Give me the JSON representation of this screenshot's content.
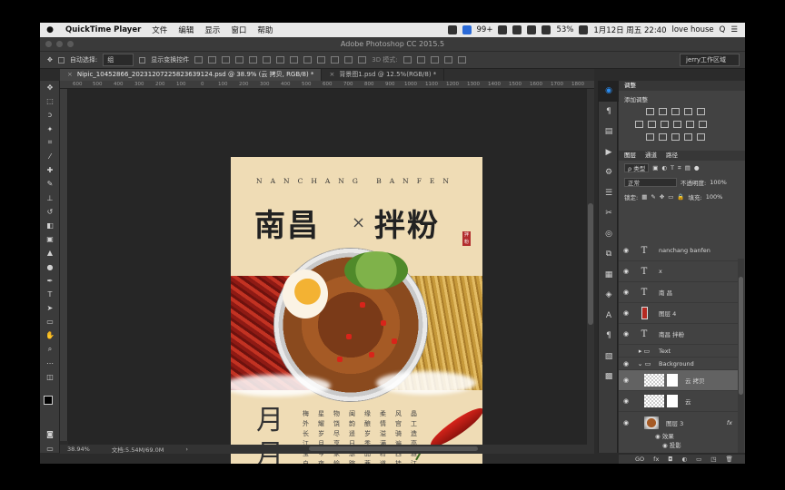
{
  "menubar": {
    "apple": "",
    "app": "QuickTime Player",
    "items": [
      "文件",
      "编辑",
      "显示",
      "窗口",
      "帮助"
    ],
    "badge": "99+",
    "battery": "53%",
    "datetime": "1月12日 周五 22:40",
    "user": "love house",
    "search": "Q",
    "list": "☰"
  },
  "titlebar": {
    "title": "Adobe Photoshop CC 2015.5"
  },
  "options": {
    "auto_select_label": "自动选择:",
    "auto_select_value": "组",
    "show_transform_label": "显示变换控件",
    "mode_3d": "3D 模式:",
    "workspace": "jerry工作区域"
  },
  "tabs": [
    {
      "close": "×",
      "label": "Nipic_10452866_20231207225823639124.psd @ 38.9% (云 拷贝, RGB/8) *"
    },
    {
      "close": "×",
      "label": "背景图1.psd @ 12.5%(RGB/8) *"
    }
  ],
  "ruler": [
    "600",
    "500",
    "400",
    "300",
    "200",
    "100",
    "0",
    "100",
    "200",
    "300",
    "400",
    "500",
    "600",
    "700",
    "800",
    "900",
    "1000",
    "1100",
    "1200",
    "1300",
    "1400",
    "1500",
    "1600",
    "1700",
    "1800"
  ],
  "status": {
    "zoom": "38.94%",
    "doc": "文档:5.54M/69.0M",
    "arrow": "›"
  },
  "poster": {
    "subtitle": "NANCHANG BANFEN",
    "title_left": "南昌",
    "title_x": "×",
    "title_right": "拌粉",
    "seal": "拌粉",
    "moon_top": "月",
    "moon_bottom": "月",
    "poem": [
      "晶工造高雅江浙",
      "风宫骑遍西挂饭",
      "柔情溢满粉道深",
      "缘酿岁季品蒂欢",
      "闽韵遥日想踪",
      "物饶尽享家愉",
      "星耀岁月今夜在",
      "梅外长江宝白渡"
    ]
  },
  "panels": {
    "adjust_tab": "调整",
    "adjust_title": "添加调整",
    "layer_tabs": [
      "图层",
      "通道",
      "路径"
    ],
    "kind": "ρ 类型",
    "blend": "正常",
    "opacity_label": "不透明度:",
    "opacity": "100%",
    "lock_label": "锁定:",
    "fill_label": "填充:",
    "fill": "100%",
    "layers": [
      {
        "name": "nanchang banfen",
        "thumb": "T",
        "eye": "◉"
      },
      {
        "name": "x",
        "thumb": "T",
        "eye": "◉"
      },
      {
        "name": "南 昌",
        "thumb": "T",
        "eye": "◉"
      },
      {
        "name": "图层 4",
        "thumb": "",
        "eye": "◉"
      },
      {
        "name": "南昌 拌粉",
        "thumb": "T",
        "eye": "◉"
      },
      {
        "name": "Text",
        "thumb": "▸ ▭",
        "eye": ""
      },
      {
        "name": "Background",
        "thumb": "⌄ ▭",
        "eye": "◉"
      },
      {
        "name": "云 拷贝",
        "thumb": "",
        "eye": "◉"
      },
      {
        "name": "云",
        "thumb": "",
        "eye": "◉"
      },
      {
        "name": "图层 3",
        "thumb": "",
        "eye": "◉"
      }
    ],
    "fx": "fx",
    "effects": "◉ 效果",
    "shadow": "◉ 投影",
    "footer": [
      "GO",
      "fx",
      "◘",
      "◐",
      "▭",
      "◳",
      "🗑"
    ]
  }
}
